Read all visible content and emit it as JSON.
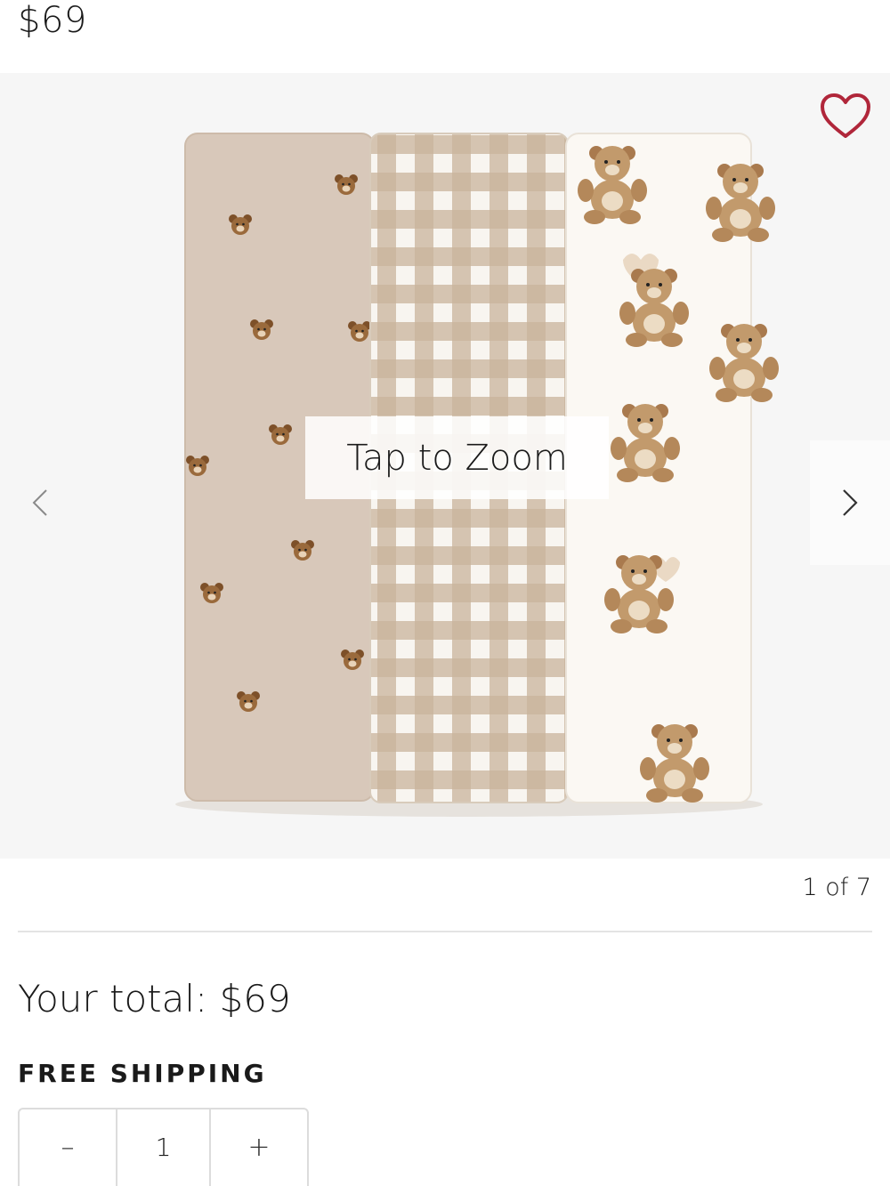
{
  "product": {
    "price": "$69"
  },
  "gallery": {
    "zoom_label": "Tap to Zoom",
    "counter": "1 of 7",
    "favorite_icon": "heart-outline-icon",
    "prev_icon": "chevron-left-icon",
    "next_icon": "chevron-right-icon",
    "image_alt": "Three rolled muslin swaddle blankets: beige with teddy bear faces, beige gingham check, and white with teddy bears"
  },
  "summary": {
    "total": "Your total: $69",
    "shipping": "FREE SHIPPING"
  },
  "quantity": {
    "decrement": "–",
    "value": "1",
    "increment": "+"
  },
  "colors": {
    "heart": "#b0263a",
    "gallery_bg": "#f6f6f6",
    "beige": "#d7c6b7",
    "gingham": "#c7b29a",
    "cream": "#fbf8f3",
    "bear": "#9a6a3c"
  }
}
